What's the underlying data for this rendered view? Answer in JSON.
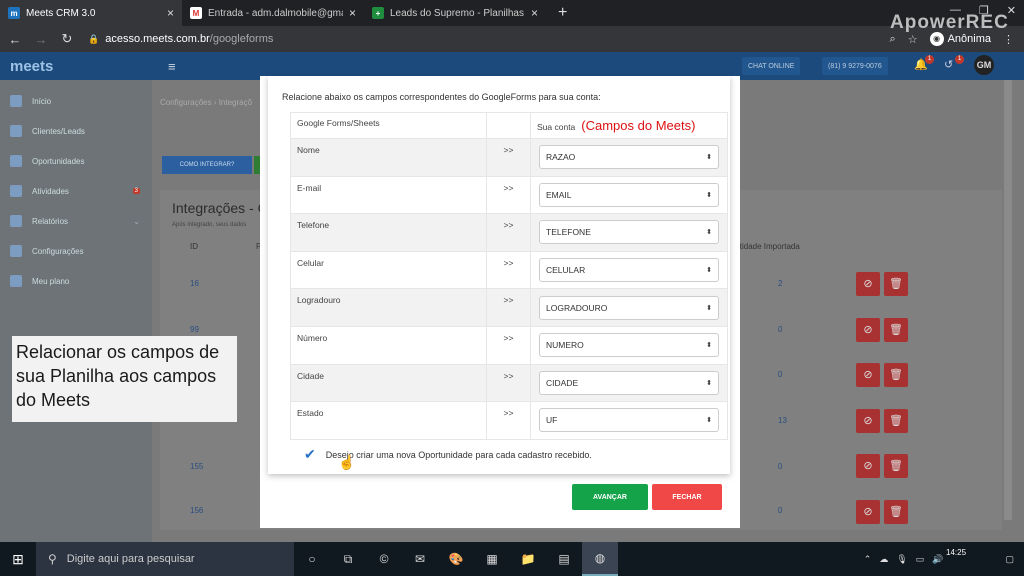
{
  "browser": {
    "tabs": [
      {
        "title": "Meets CRM 3.0",
        "favicon": "meets-icon",
        "active": true
      },
      {
        "title": "Entrada - adm.dalmobile@gmail.",
        "favicon": "gmail-icon",
        "active": false
      },
      {
        "title": "Leads do Supremo - Planilhas Go",
        "favicon": "sheets-icon",
        "active": false
      }
    ],
    "new_tab": "+",
    "url_domain": "acesso.meets.com.br",
    "url_path": "/googleforms",
    "profile": "Anônima",
    "watermark": "ApowerREC"
  },
  "app": {
    "logo": "meets",
    "chat_online": "CHAT ONLINE",
    "phone": "(81) 9 9279-0076",
    "notif_count": "1",
    "notif_count2": "1",
    "avatar": "GM",
    "sidebar": [
      {
        "label": "Início",
        "icon": "home-icon"
      },
      {
        "label": "Clientes/Leads",
        "icon": "clients-icon"
      },
      {
        "label": "Oportunidades",
        "icon": "briefcase-icon"
      },
      {
        "label": "Atividades",
        "icon": "check-icon",
        "badge": "3"
      },
      {
        "label": "Relatórios",
        "icon": "chart-icon",
        "caret": "⌄"
      },
      {
        "label": "Configurações",
        "icon": "gear-icon"
      },
      {
        "label": "Meu plano",
        "icon": "user-icon"
      }
    ],
    "breadcrumb": "Configurações  ›  Integraçõ",
    "btn_como_integrar": "COMO INTEGRAR?",
    "page_title": "Integrações - G",
    "page_note": "Após integrado, seus dados",
    "col_id": "ID",
    "col_p": "P",
    "col_qtd": "itidade Importada",
    "rows": [
      {
        "id": "16",
        "qtd": "2"
      },
      {
        "id": "99",
        "qtd": "0"
      },
      {
        "id": "",
        "qtd": "0"
      },
      {
        "id": "",
        "qtd": "13"
      },
      {
        "id": "155",
        "qtd": "0"
      },
      {
        "id": "156",
        "qtd": "0"
      }
    ],
    "row_p_fragment": "P"
  },
  "annotation": {
    "text_lines": [
      "Relacionar os campos de",
      "sua Planilha aos campos",
      "do Meets"
    ]
  },
  "modal": {
    "instruction": "Relacione abaixo os campos correspondentes do GoogleForms para sua conta:",
    "col_left": "Google Forms/Sheets",
    "col_right": "Sua conta",
    "red_annotation": "(Campos do Meets)",
    "arrow": ">>",
    "fields": [
      {
        "source": "Nome",
        "target": "RAZAO"
      },
      {
        "source": "E-mail",
        "target": "EMAIL"
      },
      {
        "source": "Telefone",
        "target": "TELEFONE"
      },
      {
        "source": "Celular",
        "target": "CELULAR"
      },
      {
        "source": "Logradouro",
        "target": "LOGRADOURO"
      },
      {
        "source": "Número",
        "target": "NUMERO"
      },
      {
        "source": "Cidade",
        "target": "CIDADE"
      },
      {
        "source": "Estado",
        "target": "UF"
      }
    ],
    "checkbox_label": "Desejo criar uma nova Oportunidade para cada cadastro recebido.",
    "checkbox_checked": true,
    "btn_next": "AVANÇAR",
    "btn_close": "FECHAR",
    "colors": {
      "next": "#15a34a",
      "close": "#f04747",
      "accent": "#1d4a7d"
    }
  },
  "taskbar": {
    "search_placeholder": "Digite aqui para pesquisar",
    "time": "14:25"
  }
}
